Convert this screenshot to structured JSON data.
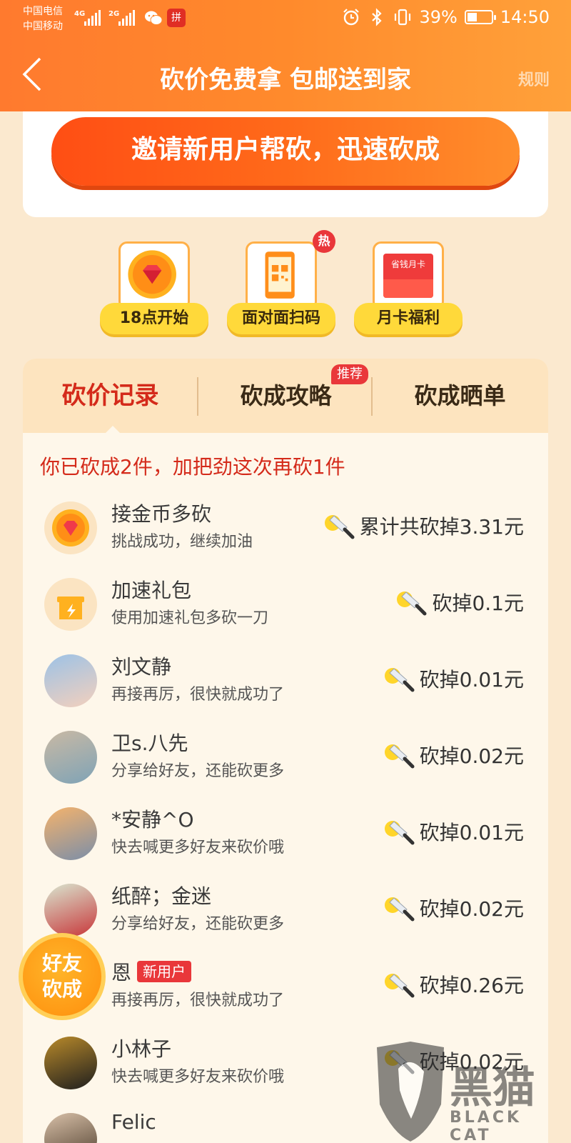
{
  "status_bar": {
    "carrier_1": "中国电信",
    "carrier_2": "中国移动",
    "net_1": "4G",
    "net_2": "2G",
    "app_icon": "拼",
    "battery": "39%",
    "time": "14:50",
    "icons": [
      "alarm-icon",
      "bluetooth-icon",
      "vibrate-icon",
      "battery-icon"
    ]
  },
  "nav": {
    "title": "砍价免费拿 包邮送到家",
    "rule": "规则"
  },
  "invite": {
    "button_label": "邀请新用户帮砍，迅速砍成"
  },
  "features": [
    {
      "label": "18点开始",
      "icon": "gem-coin-icon"
    },
    {
      "label": "面对面扫码",
      "icon": "qr-phone-icon",
      "badge": "热"
    },
    {
      "label": "月卡福利",
      "icon": "month-card-icon",
      "card_text": "省钱月卡"
    }
  ],
  "tabs": [
    {
      "label": "砍价记录",
      "active": true
    },
    {
      "label": "砍成攻略",
      "badge": "推荐"
    },
    {
      "label": "砍成晒单"
    }
  ],
  "summary": "你已砍成2件，加把劲这次再砍1件",
  "records": [
    {
      "name": "接金币多砍",
      "desc": "挑战成功，继续加油",
      "amount": "累计共砍掉3.31元",
      "avatar": "gem-coin"
    },
    {
      "name": "加速礼包",
      "desc": "使用加速礼包多砍一刀",
      "amount": "砍掉0.1元",
      "avatar": "gift"
    },
    {
      "name": "刘文静",
      "desc": "再接再厉，很快就成功了",
      "amount": "砍掉0.01元",
      "avatar": "photo"
    },
    {
      "name": "卫s.八先",
      "desc": "分享给好友，还能砍更多",
      "amount": "砍掉0.02元",
      "avatar": "photo"
    },
    {
      "name": "*安静^O",
      "desc": "快去喊更多好友来砍价哦",
      "amount": "砍掉0.01元",
      "avatar": "photo"
    },
    {
      "name": "纸醉；金迷",
      "desc": "分享给好友，还能砍更多",
      "amount": "砍掉0.02元",
      "avatar": "photo"
    },
    {
      "name": "恩",
      "tag": "新用户",
      "desc": "再接再厉，很快就成功了",
      "amount": "砍掉0.26元",
      "avatar": "photo"
    },
    {
      "name": "小林子",
      "desc": "快去喊更多好友来砍价哦",
      "amount": "砍掉0.02元",
      "avatar": "photo"
    },
    {
      "name": "Felic",
      "desc": "",
      "amount": "",
      "avatar": "photo"
    }
  ],
  "friend_badge": {
    "line1": "好友",
    "line2": "砍成"
  },
  "watermark": {
    "main": "黑猫",
    "sub": "BLACK CAT"
  },
  "colors": {
    "brand_orange": "#ff7a2e",
    "accent_red": "#d42a1a",
    "panel_bg": "#fef7ea"
  }
}
